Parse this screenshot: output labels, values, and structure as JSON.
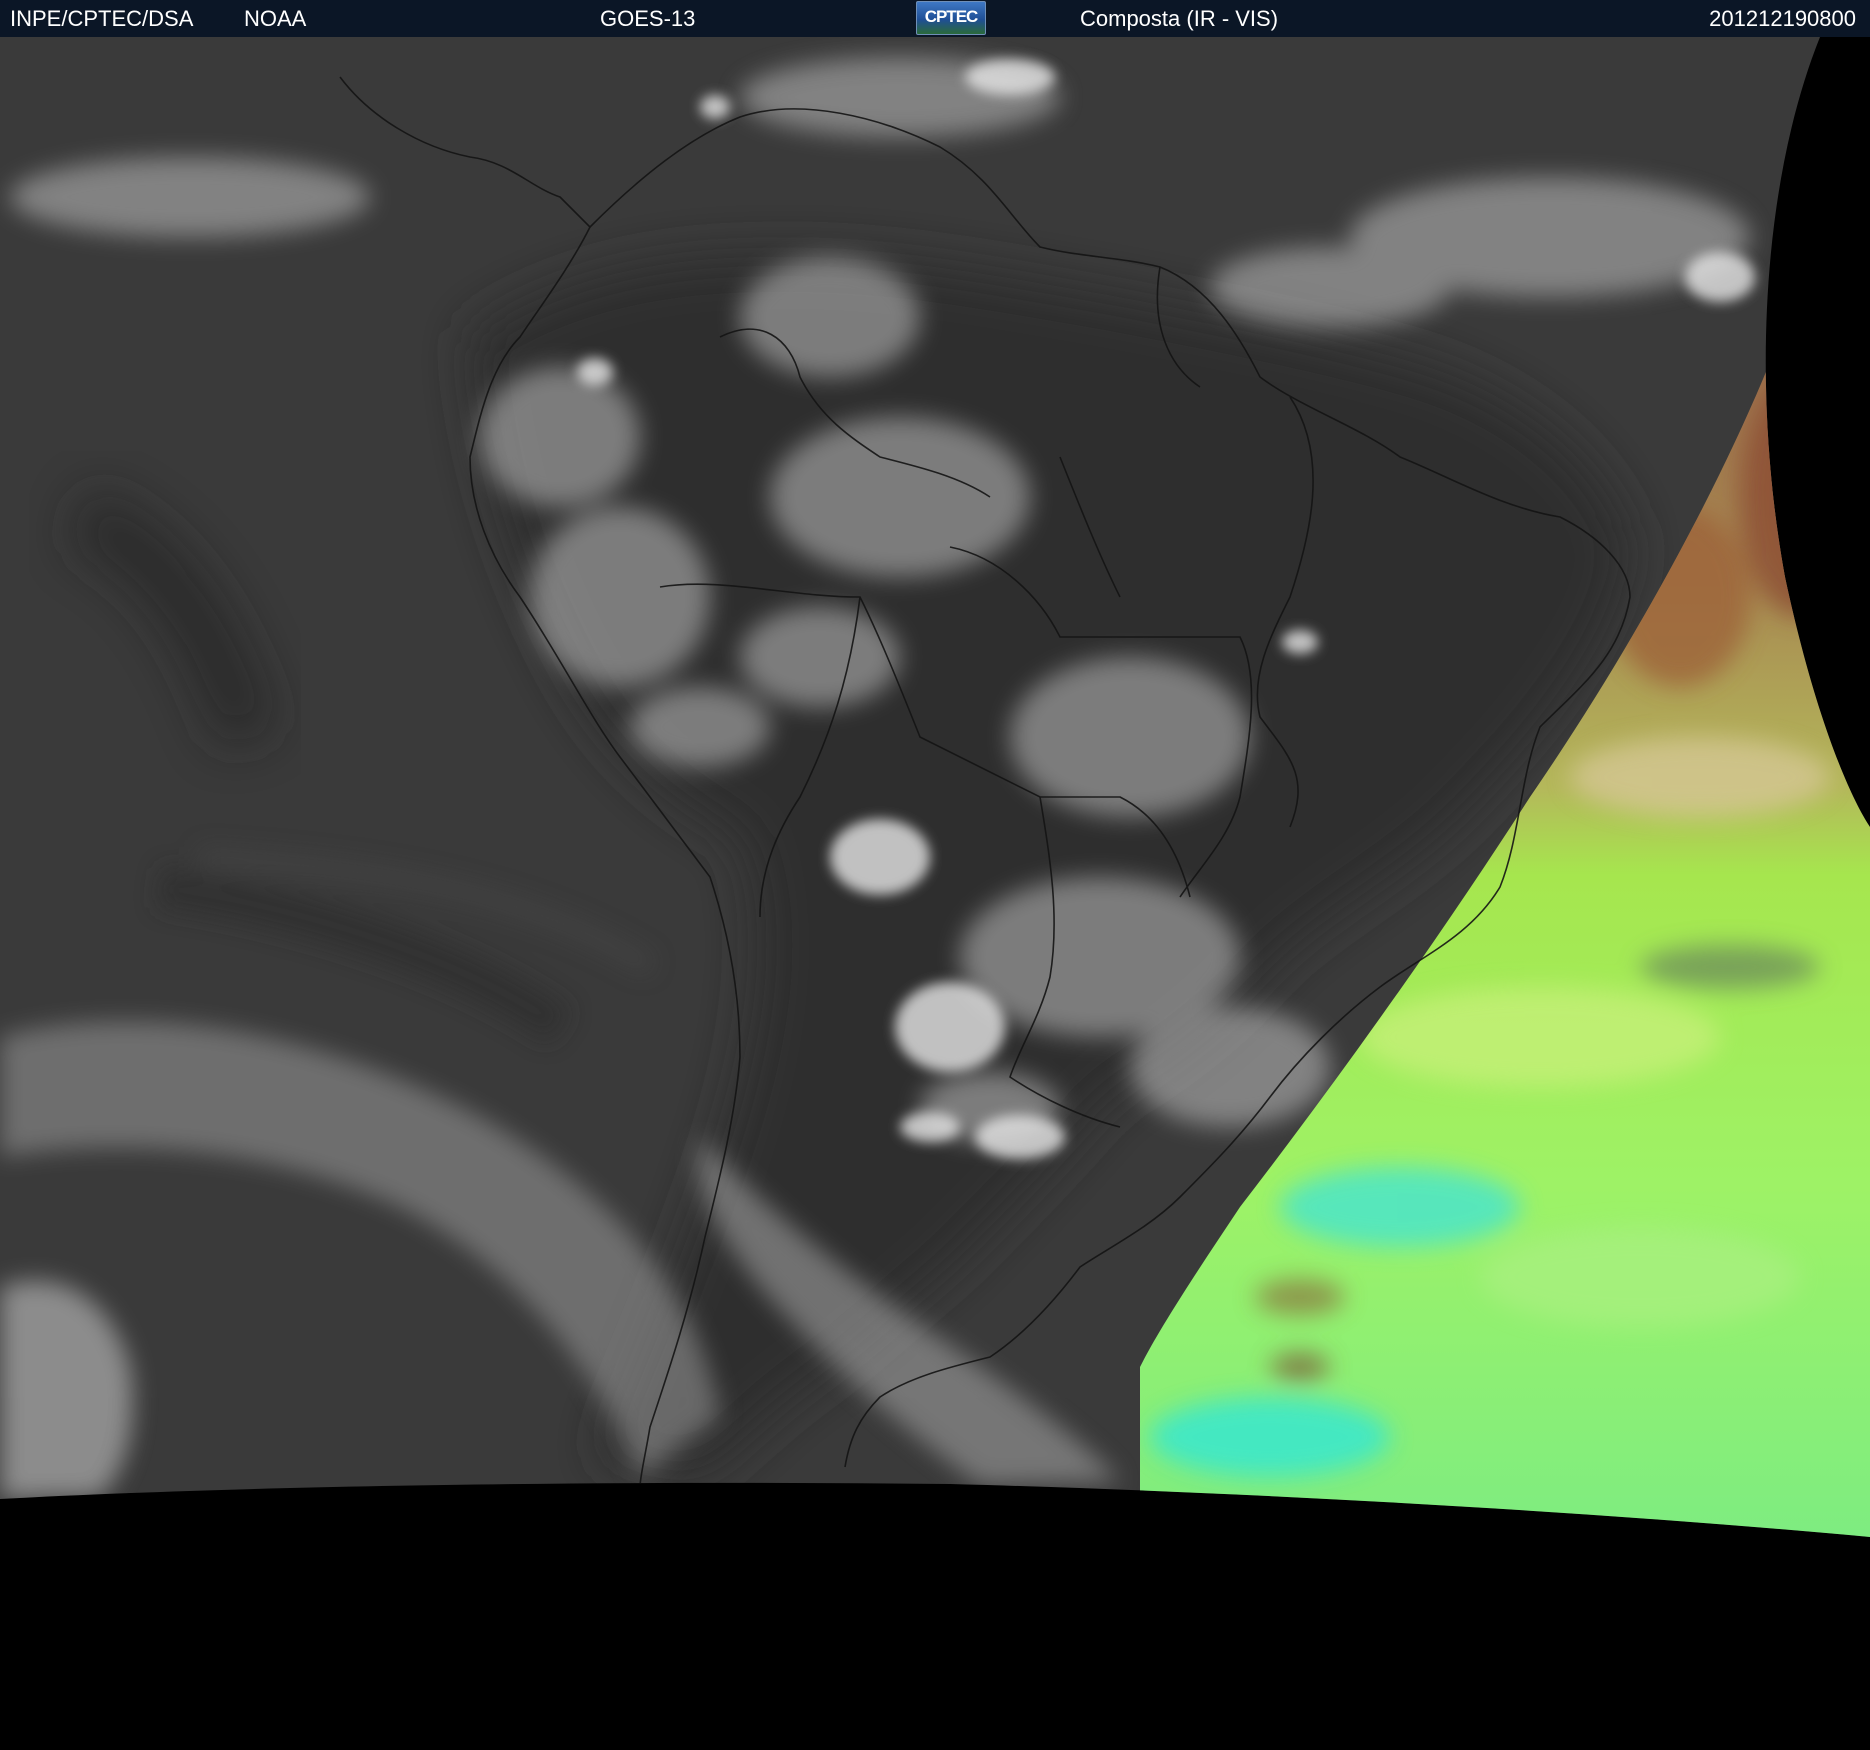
{
  "header": {
    "agency": "INPE/CPTEC/DSA",
    "source": "NOAA",
    "satellite": "GOES-13",
    "logo_text": "CPTEC",
    "product": "Composta (IR - VIS)",
    "timestamp": "201212190800"
  },
  "imagery": {
    "region": "South America",
    "left_panel": "IR grayscale",
    "right_panel": "VIS color composite",
    "background_color": "#000000"
  }
}
